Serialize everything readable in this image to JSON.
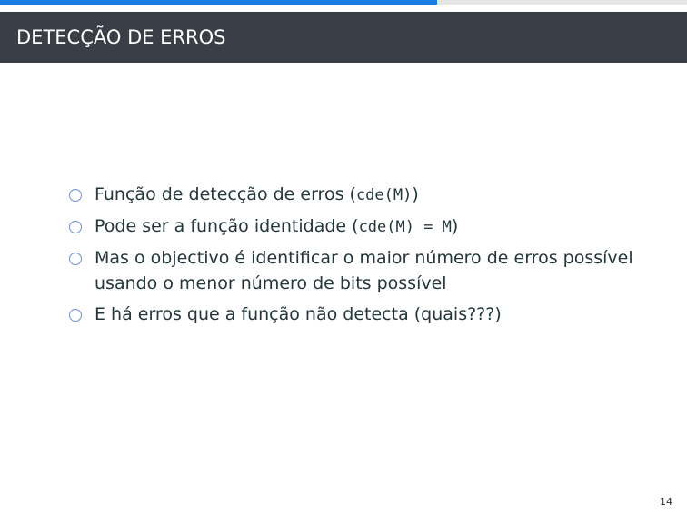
{
  "progress": {
    "fraction": 0.636,
    "fill_color": "#1a7be0",
    "track_color": "#e5e5e5"
  },
  "header": {
    "title": "DETECÇÃO DE ERROS",
    "background_color": "#3a3e47"
  },
  "bullets": [
    {
      "text_before": "Função de detecção de erros (",
      "code": "cde(M)",
      "text_after": ")"
    },
    {
      "text_before": "Pode ser a função identidade (",
      "code": "cde(M) = M",
      "text_after": ")"
    },
    {
      "text_before": "Mas o objectivo é identificar o maior número de erros possível usando o menor número de bits possível",
      "code": "",
      "text_after": ""
    },
    {
      "text_before": "E há erros que a função não detecta (quais???)",
      "code": "",
      "text_after": ""
    }
  ],
  "bullet_marker": {
    "icon": "hollow-circle-icon",
    "color": "#6b8fd6"
  },
  "page_number": "14"
}
